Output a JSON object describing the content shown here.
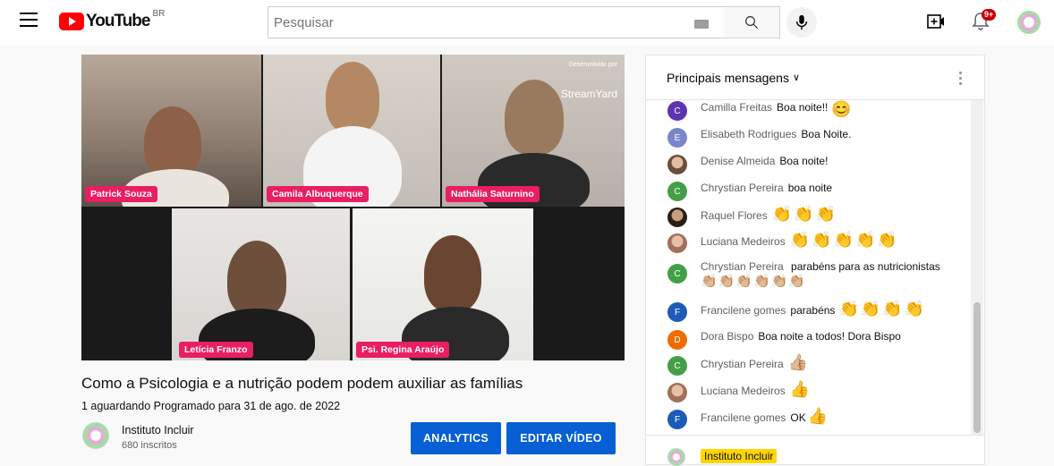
{
  "header": {
    "logo_text": "YouTube",
    "region": "BR",
    "search_placeholder": "Pesquisar",
    "notification_count": "9+"
  },
  "video": {
    "brand_small": "Desenvolvido por",
    "brand_name": "StreamYard",
    "participants": [
      "Patrick Souza",
      "Camila Albuquerque",
      "Nathália Saturnino",
      "Letícia Franzo",
      "Psi. Regina Araújo"
    ],
    "title": "Como a Psicologia e a nutrição podem podem auxiliar as famílias",
    "meta": "1 aguardando  Programado para 31 de ago. de 2022"
  },
  "channel": {
    "name": "Instituto Incluir",
    "subscribers": "680 inscritos"
  },
  "actions": {
    "analytics": "ANALYTICS",
    "edit": "EDITAR VÍDEO"
  },
  "chat": {
    "header": "Principais mensagens",
    "messages": [
      {
        "author": "Camilla Freitas",
        "text": "Boa noite!!",
        "emoji": "😊",
        "avatar": "C",
        "color": "#5e35b1"
      },
      {
        "author": "Elisabeth Rodrigues",
        "text": "Boa Noite.",
        "emoji": "",
        "avatar": "E",
        "color": "#7986cb"
      },
      {
        "author": "Denise Almeida",
        "text": "Boa noite!",
        "emoji": "",
        "avatar": "",
        "color": "#a1887f"
      },
      {
        "author": "Chrystian Pereira",
        "text": "boa noite",
        "emoji": "",
        "avatar": "C",
        "color": "#43a047"
      },
      {
        "author": "Raquel Flores",
        "text": "",
        "emoji": "👏👏👏",
        "avatar": "",
        "color": "#3e2723"
      },
      {
        "author": "Luciana Medeiros",
        "text": "",
        "emoji": "👏👏👏👏👏",
        "avatar": "",
        "color": "#c69c8d"
      },
      {
        "author": "Chrystian Pereira",
        "text": "parabéns para as nutricionistas",
        "emoji": "👏🏼👏🏼👏🏼👏🏼👏🏼👏🏼",
        "avatar": "C",
        "color": "#43a047"
      },
      {
        "author": "Francilene gomes",
        "text": "parabéns",
        "emoji": "👏👏👏👏",
        "avatar": "F",
        "color": "#1e5bb8"
      },
      {
        "author": "Dora Bispo",
        "text": "Boa noite a todos! Dora Bispo",
        "emoji": "",
        "avatar": "D",
        "color": "#ef6c00"
      },
      {
        "author": "Chrystian Pereira",
        "text": "",
        "emoji": "👍🏼",
        "avatar": "C",
        "color": "#43a047"
      },
      {
        "author": "Luciana Medeiros",
        "text": "",
        "emoji": "👍",
        "avatar": "",
        "color": "#c69c8d"
      },
      {
        "author": "Francilene gomes",
        "text": "OK",
        "emoji": "👍",
        "avatar": "F",
        "color": "#1e5bb8"
      }
    ],
    "footer_author": "Instituto Incluir"
  },
  "colors": {
    "accent_blue": "#065fd4",
    "name_tag": "#e91e63",
    "brand_red": "#ff0000",
    "owner_highlight": "#ffd600"
  }
}
